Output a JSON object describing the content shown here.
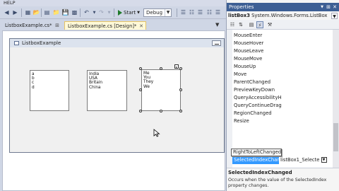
{
  "menu": {
    "help": "HELP"
  },
  "toolbar": {
    "start_label": "Start",
    "config_value": "Debug"
  },
  "tabs": [
    {
      "label": "ListboxExample.cs*"
    },
    {
      "label": "ListboxExample.cs [Design]*"
    }
  ],
  "form": {
    "title": "ListboxExample",
    "listbox1": [
      "a",
      "b",
      "c",
      "d"
    ],
    "listbox2": [
      "India",
      "USA",
      "Britain",
      "China"
    ],
    "listbox3": [
      "Me",
      "You",
      "They",
      "We"
    ]
  },
  "properties": {
    "title": "Properties",
    "object_name": "listBox3",
    "object_type": "System.Windows.Forms.ListBox",
    "events": [
      "MouseEnter",
      "MouseHover",
      "MouseLeave",
      "MouseMove",
      "MouseUp",
      "Move",
      "ParentChanged",
      "PreviewKeyDown",
      "QueryAccessibilityH",
      "QueryContinueDrag",
      "RegionChanged",
      "Resize"
    ],
    "tooltip": "RightToLeftChanged",
    "selected_event": "SelectedIndexChang",
    "selected_value": "listBox1_Selecte",
    "description_title": "SelectedIndexChanged",
    "description_body": "Occurs when the value of the SelectedIndex property changes."
  },
  "colors": {
    "accent": "#3399ff",
    "panel_title": "#3d5f94"
  }
}
